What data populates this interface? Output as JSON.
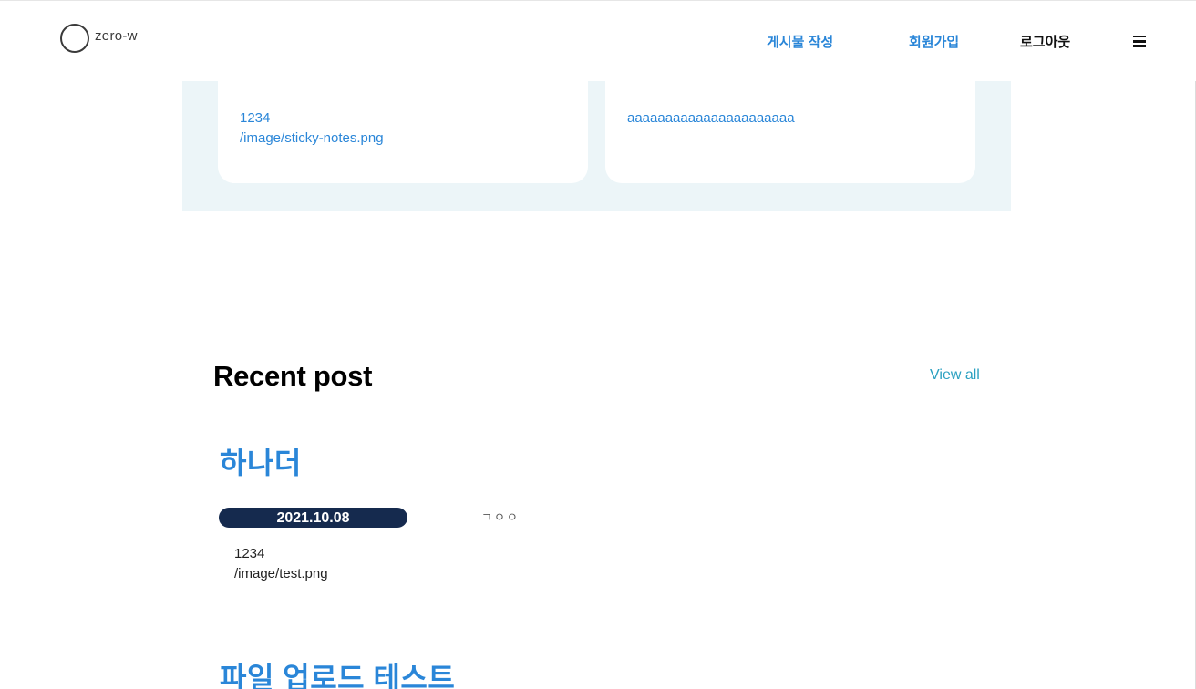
{
  "header": {
    "logo_text": "zero-w",
    "nav": {
      "write_post": "게시물 작성",
      "signup": "회원가입",
      "logout": "로그아웃"
    },
    "menu_icon": "hamburger-menu-icon"
  },
  "featured": {
    "cards": [
      {
        "lines": [
          "1234",
          "/image/sticky-notes.png"
        ]
      },
      {
        "lines": [
          "aaaaaaaaaaaaaaaaaaaaaa"
        ]
      }
    ]
  },
  "recent": {
    "title": "Recent post",
    "view_all": "View all",
    "posts": [
      {
        "title": "하나더",
        "date": "2021.10.08",
        "snippet": "ㄱㅇㅇ",
        "body_lines": [
          "1234",
          "/image/test.png"
        ]
      },
      {
        "title": "파일 업로드 테스트"
      }
    ]
  },
  "colors": {
    "accent_blue": "#2a86d8",
    "view_all_teal": "#2aa0c0",
    "badge_navy": "#152a4e",
    "featured_bg": "#ecf5f8"
  }
}
